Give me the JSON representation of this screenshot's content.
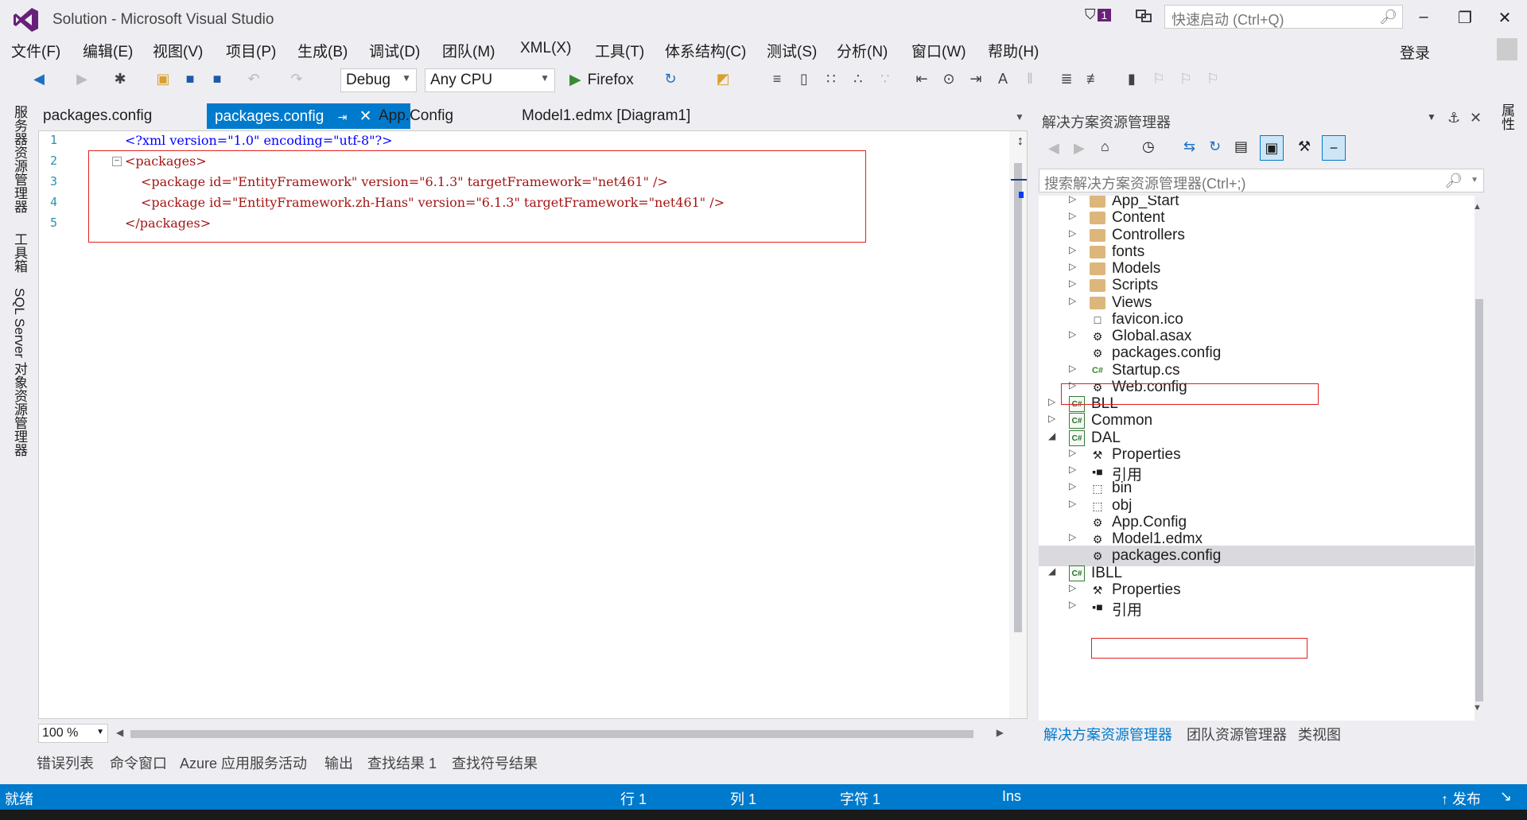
{
  "window": {
    "title": "Solution - Microsoft Visual Studio",
    "notification_count": "1",
    "quick_launch_placeholder": "快速启动 (Ctrl+Q)",
    "login": "登录"
  },
  "menu": [
    "文件(F)",
    "编辑(E)",
    "视图(V)",
    "项目(P)",
    "生成(B)",
    "调试(D)",
    "团队(M)",
    "XML(X)",
    "工具(T)",
    "体系结构(C)",
    "测试(S)",
    "分析(N)",
    "窗口(W)",
    "帮助(H)"
  ],
  "toolbar": {
    "config": "Debug",
    "platform": "Any CPU",
    "run_target": "Firefox"
  },
  "left_tabs": [
    "服务器资源管理器",
    "工具箱",
    "SQL Server 对象资源管理器"
  ],
  "right_tab": "属性",
  "doc_tabs": [
    {
      "label": "packages.config",
      "active": false
    },
    {
      "label": "packages.config",
      "active": true
    },
    {
      "label": "App.Config",
      "active": false
    },
    {
      "label": "Model1.edmx [Diagram1]",
      "active": false
    }
  ],
  "editor": {
    "lines": [
      {
        "num": "1",
        "text": "<?xml version=\"1.0\" encoding=\"utf-8\"?>"
      },
      {
        "num": "2",
        "text": "<packages>"
      },
      {
        "num": "3",
        "text": "<package id=\"EntityFramework\" version=\"6.1.3\" targetFramework=\"net461\" />"
      },
      {
        "num": "4",
        "text": "<package id=\"EntityFramework.zh-Hans\" version=\"6.1.3\" targetFramework=\"net461\" />"
      },
      {
        "num": "5",
        "text": "</packages>"
      }
    ],
    "zoom": "100 %"
  },
  "solution_explorer": {
    "title": "解决方案资源管理器",
    "search_placeholder": "搜索解决方案资源管理器(Ctrl+;)",
    "items": [
      {
        "label": "App_Start",
        "type": "folder",
        "level": 2,
        "expander": "collapsed"
      },
      {
        "label": "Content",
        "type": "folder",
        "level": 2,
        "expander": "collapsed"
      },
      {
        "label": "Controllers",
        "type": "folder",
        "level": 2,
        "expander": "collapsed"
      },
      {
        "label": "fonts",
        "type": "folder",
        "level": 2,
        "expander": "collapsed"
      },
      {
        "label": "Models",
        "type": "folder",
        "level": 2,
        "expander": "collapsed"
      },
      {
        "label": "Scripts",
        "type": "folder",
        "level": 2,
        "expander": "collapsed"
      },
      {
        "label": "Views",
        "type": "folder",
        "level": 2,
        "expander": "collapsed"
      },
      {
        "label": "favicon.ico",
        "type": "file",
        "level": 2,
        "expander": "none"
      },
      {
        "label": "Global.asax",
        "type": "asax",
        "level": 2,
        "expander": "collapsed"
      },
      {
        "label": "packages.config",
        "type": "config",
        "level": 2,
        "expander": "none"
      },
      {
        "label": "Startup.cs",
        "type": "cs",
        "level": 2,
        "expander": "collapsed"
      },
      {
        "label": "Web.config",
        "type": "config",
        "level": 2,
        "expander": "collapsed"
      },
      {
        "label": "BLL",
        "type": "project",
        "level": 1,
        "expander": "collapsed"
      },
      {
        "label": "Common",
        "type": "project",
        "level": 1,
        "expander": "collapsed"
      },
      {
        "label": "DAL",
        "type": "project",
        "level": 1,
        "expander": "expanded"
      },
      {
        "label": "Properties",
        "type": "wrench",
        "level": 2,
        "expander": "collapsed"
      },
      {
        "label": "引用",
        "type": "ref",
        "level": 2,
        "expander": "collapsed"
      },
      {
        "label": "bin",
        "type": "dashfolder",
        "level": 2,
        "expander": "collapsed"
      },
      {
        "label": "obj",
        "type": "dashfolder",
        "level": 2,
        "expander": "collapsed"
      },
      {
        "label": "App.Config",
        "type": "config",
        "level": 2,
        "expander": "none"
      },
      {
        "label": "Model1.edmx",
        "type": "edmx",
        "level": 2,
        "expander": "collapsed"
      },
      {
        "label": "packages.config",
        "type": "config",
        "level": 2,
        "expander": "none",
        "selected": true
      },
      {
        "label": "IBLL",
        "type": "project",
        "level": 1,
        "expander": "expanded"
      },
      {
        "label": "Properties",
        "type": "wrench",
        "level": 2,
        "expander": "collapsed"
      },
      {
        "label": "引用",
        "type": "ref",
        "level": 2,
        "expander": "collapsed"
      }
    ],
    "tabs": [
      "解决方案资源管理器",
      "团队资源管理器",
      "类视图"
    ]
  },
  "bottom_tabs": [
    "错误列表",
    "命令窗口",
    "Azure 应用服务活动",
    "输出",
    "查找结果 1",
    "查找符号结果"
  ],
  "status": {
    "ready": "就绪",
    "line": "行 1",
    "col": "列 1",
    "char": "字符 1",
    "mode": "Ins",
    "publish": "发布"
  },
  "colors": {
    "accent": "#007acc",
    "highlight_box": "#e02020",
    "vs_purple": "#68217a"
  }
}
